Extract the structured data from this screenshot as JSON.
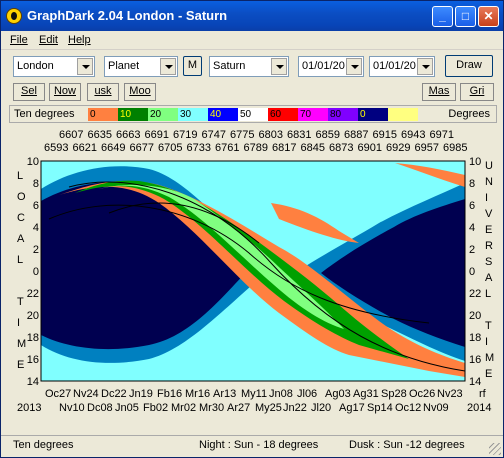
{
  "window": {
    "title": "GraphDark 2.04  London  -  Saturn",
    "min": "_",
    "max": "□",
    "close": "✕"
  },
  "menu": [
    "File",
    "Edit",
    "Help"
  ],
  "toolbar": {
    "location": "London",
    "object_type": "Planet",
    "m_label": "M",
    "object": "Saturn",
    "date_from": "01/01/20",
    "date_to": "01/01/20",
    "draw_label": "Draw"
  },
  "toolbar2": {
    "sel": "Sel",
    "now": "Now",
    "usk": "usk",
    "moo": "Moo",
    "mas": "Mas",
    "gri": "Gri"
  },
  "legend": {
    "title": "Ten degrees",
    "end_label": "Degrees",
    "labels": [
      "0",
      "10",
      "20",
      "30",
      "40",
      "50",
      "60",
      "70",
      "80",
      "0"
    ],
    "colors": [
      "#ff8040",
      "#008000",
      "#80ff80",
      "#80ffff",
      "#0000ff",
      "#ffffff",
      "#ff0000",
      "#ff00ff",
      "#8000ff",
      "#000080",
      "#ffff80"
    ]
  },
  "top_axis": {
    "row1": [
      "6607",
      "6635",
      "6663",
      "6691",
      "6719",
      "6747",
      "6775",
      "6803",
      "6831",
      "6859",
      "6887",
      "6915",
      "6943",
      "6971"
    ],
    "row2": [
      "6593",
      "6621",
      "6649",
      "6677",
      "6705",
      "6733",
      "6761",
      "6789",
      "6817",
      "6845",
      "6873",
      "6901",
      "6929",
      "6957",
      "6985"
    ]
  },
  "left_axis": {
    "ticks": [
      "10",
      "8",
      "6",
      "4",
      "2",
      "0",
      "22",
      "20",
      "18",
      "16",
      "14"
    ],
    "letters": [
      "L",
      "O",
      "C",
      "A",
      "L",
      "",
      "T",
      "I",
      "M",
      "E"
    ]
  },
  "right_axis": {
    "ticks": [
      "10",
      "8",
      "6",
      "4",
      "2",
      "0",
      "22",
      "20",
      "18",
      "16",
      "14"
    ],
    "letters": [
      "U",
      "N",
      "I",
      "V",
      "E",
      "R",
      "S",
      "A",
      "L",
      "",
      "T",
      "I",
      "M",
      "E"
    ]
  },
  "bottom_axis": {
    "row1": [
      "Oc27",
      "Nv24",
      "Dc22",
      "Jn19",
      "Fb16",
      "Mr16",
      "Ar13",
      "My11",
      "Jn08",
      "Jl06",
      "Ag03",
      "Ag31",
      "Sp28",
      "Oc26",
      "Nv23"
    ],
    "row2": [
      "Nv10",
      "Dc08",
      "Jn05",
      "Fb02",
      "Mr02",
      "Mr30",
      "Ar27",
      "My25",
      "Jn22",
      "Jl20",
      "Ag17",
      "Sp14",
      "Oc12",
      "Nv09"
    ],
    "year_left": "2013",
    "year_right": "2014",
    "corner_right": "rf"
  },
  "status": {
    "left": "Ten degrees",
    "middle": "Night : Sun - 18 degrees",
    "right": "Dusk : Sun -12 degrees"
  },
  "colors": {
    "sky": "#80ffff",
    "night": "#000050",
    "dusk": "#0080c0",
    "band_orange": "#ff8040",
    "band_green": "#00a000",
    "band_lightgreen": "#80ff80"
  }
}
